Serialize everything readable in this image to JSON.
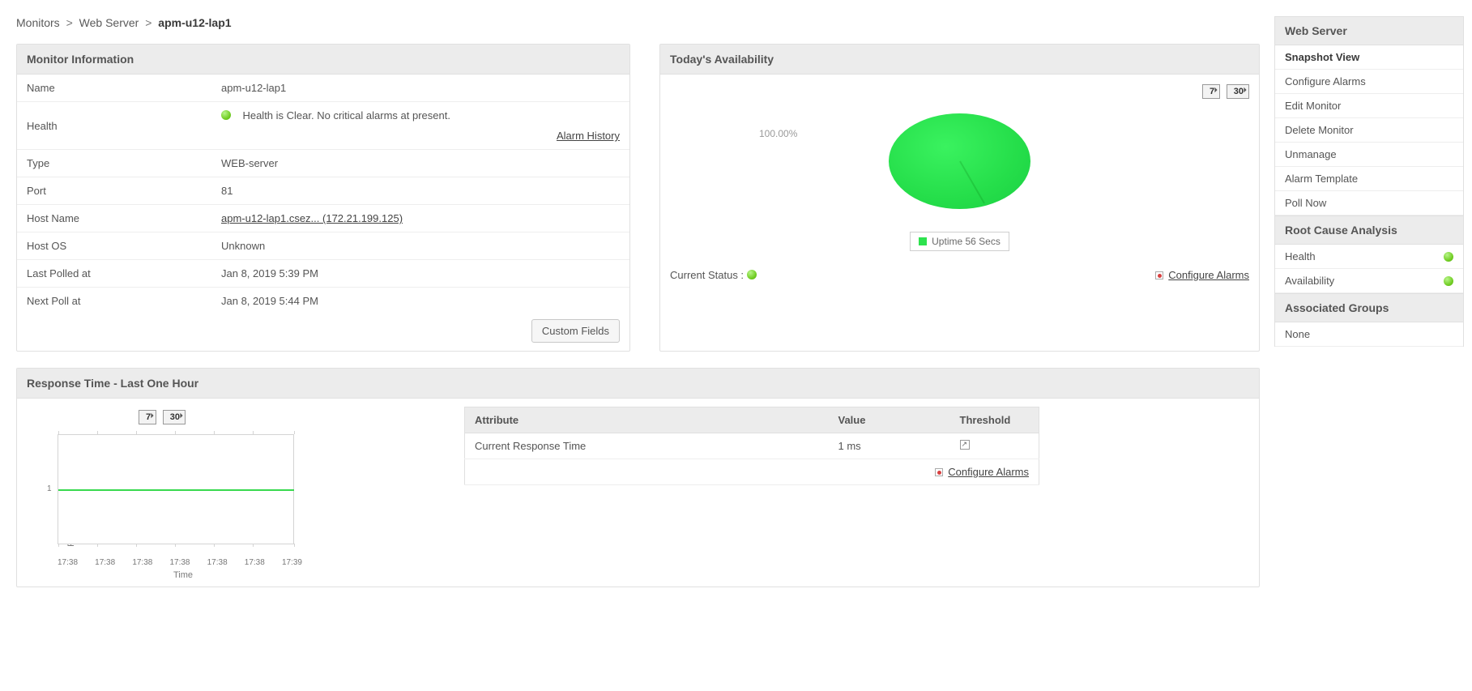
{
  "breadcrumb": {
    "a": "Monitors",
    "b": "Web Server",
    "current": "apm-u12-lap1"
  },
  "monitor_info": {
    "header": "Monitor Information",
    "name_label": "Name",
    "name_value": "apm-u12-lap1",
    "health_label": "Health",
    "health_value": "Health is Clear. No critical alarms at present.",
    "alarm_history": "Alarm History",
    "type_label": "Type",
    "type_value": "WEB-server",
    "port_label": "Port",
    "port_value": "81",
    "host_label": "Host Name",
    "host_value": "apm-u12-lap1.csez... (172.21.199.125)",
    "os_label": "Host OS",
    "os_value": "Unknown",
    "lastpoll_label": "Last Polled at",
    "lastpoll_value": "Jan 8, 2019 5:39 PM",
    "nextpoll_label": "Next Poll at",
    "nextpoll_value": "Jan 8, 2019 5:44 PM",
    "custom_fields": "Custom Fields"
  },
  "availability": {
    "header": "Today's Availability",
    "btn7": "7",
    "btn30": "30",
    "pct": "100.00%",
    "legend": "Uptime 56 Secs",
    "current_status_label": "Current Status :",
    "configure_alarms": "Configure Alarms"
  },
  "response_time": {
    "header": "Response Time - Last One Hour",
    "btn7": "7",
    "btn30": "30",
    "ylabel": "Response Time in ms",
    "ytick": "1",
    "xlabel": "Time",
    "xticks": [
      "17:38",
      "17:38",
      "17:38",
      "17:38",
      "17:38",
      "17:38",
      "17:39"
    ],
    "table": {
      "col1": "Attribute",
      "col2": "Value",
      "col3": "Threshold",
      "row_attr": "Current Response Time",
      "row_val": "1 ms",
      "configure_alarms": "Configure Alarms"
    }
  },
  "sidebar": {
    "h1": "Web Server",
    "items1": [
      "Snapshot View",
      "Configure Alarms",
      "Edit Monitor",
      "Delete Monitor",
      "Unmanage",
      "Alarm Template",
      "Poll Now"
    ],
    "h2": "Root Cause Analysis",
    "rca": {
      "health": "Health",
      "avail": "Availability"
    },
    "h3": "Associated Groups",
    "none": "None"
  },
  "chart_data": [
    {
      "type": "pie",
      "title": "Today's Availability",
      "series": [
        {
          "name": "Uptime 56 Secs",
          "value": 100.0
        }
      ],
      "values_pct": [
        100.0
      ]
    },
    {
      "type": "line",
      "title": "Response Time - Last One Hour",
      "xlabel": "Time",
      "ylabel": "Response Time in ms",
      "x": [
        "17:38",
        "17:38",
        "17:38",
        "17:38",
        "17:38",
        "17:38",
        "17:39"
      ],
      "series": [
        {
          "name": "Response Time",
          "values": [
            1,
            1,
            1,
            1,
            1,
            1,
            1
          ]
        }
      ],
      "ylim": [
        0,
        2
      ]
    }
  ]
}
